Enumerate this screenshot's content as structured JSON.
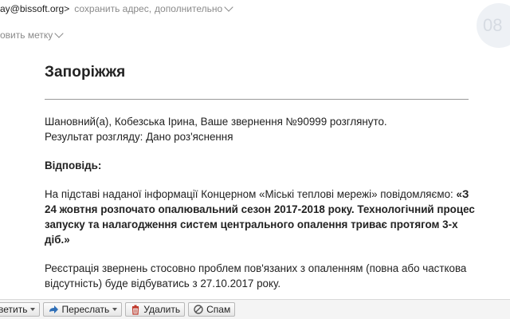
{
  "header": {
    "sender_email": "ay@bissoft.org>",
    "save_address": "сохранить адрес",
    "separator": ",",
    "more": "дополнительно",
    "label_action": "овить метку"
  },
  "message": {
    "title": "Запоріжжя",
    "greeting_line1": "Шановний(а), Кобезська Ірина, Ваше звернення №90999 розглянуто.",
    "greeting_line2": "Результат розгляду: Дано роз'яснення",
    "answer_heading": "Відповідь:",
    "answer_intro": "На підставі наданої інформації Концерном «Міські теплові мережі» повідомляємо: ",
    "answer_bold": "«З 24 жовтня розпочато опалювальний сезон 2017-2018 року. Технологічний процес запуску та налагодження систем центрального опалення триває протягом 3-х діб.»",
    "registration_note": "Реєстрація звернень стосовно проблем пов'язаних з опаленням (повна або часткова відсутність) буде відбуватись з 27.10.2017 року."
  },
  "toolbar": {
    "reply_label": "ветить",
    "forward_label": "Переслать",
    "delete_label": "Удалить",
    "spam_label": "Спам"
  },
  "corner_badge": "08",
  "colors": {
    "text": "#222222",
    "muted": "#8a8a8a",
    "rule": "#9a9a9a",
    "delete_icon": "#c0392b",
    "forward_icon": "#2f6fb7"
  }
}
